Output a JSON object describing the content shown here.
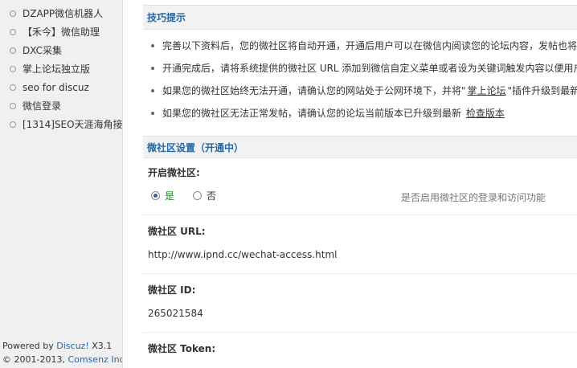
{
  "sidebar": {
    "items": [
      {
        "label": "DZAPP微信机器人"
      },
      {
        "label": "【禾今】微信助理"
      },
      {
        "label": "DXC采集"
      },
      {
        "label": "掌上论坛独立版"
      },
      {
        "label": "seo for discuz"
      },
      {
        "label": "微信登录"
      },
      {
        "label": "[1314]SEO天涯海角接"
      }
    ],
    "footer": {
      "powered_by": "Powered by",
      "discuz_link": "Discuz!",
      "version": "X3.1",
      "copyright": "© 2001-2013,",
      "comsenz_link": "Comsenz Inc."
    }
  },
  "tips": {
    "title": "技巧提示",
    "item1": "完善以下资料后，您的微社区将自动开通，开通后用户可以在微信内阅读您的论坛内容，发帖也将",
    "item2": "开通完成后，请将系统提供的微社区 URL 添加到微信自定义菜单或者设为关键词触发内容以便用户",
    "item3_before": "如果您的微社区始终无法开通，请确认您的网站处于公网环境下，并将\"",
    "item3_link": "掌上论坛",
    "item3_after": "\"插件升级到最新",
    "item4_text": "如果您的微社区无法正常发帖，请确认您的论坛当前版本已升级到最新",
    "item4_link": "检查版本"
  },
  "settings": {
    "title": "微社区设置（开通中）",
    "enable": {
      "label": "开启微社区:",
      "yes_label": "是",
      "no_label": "否",
      "selected": "是",
      "hint": "是否启用微社区的登录和访问功能"
    },
    "url": {
      "label": "微社区 URL:",
      "value": "http://www.ipnd.cc/wechat-access.html"
    },
    "id": {
      "label": "微社区 ID:",
      "value": "265021584"
    },
    "token": {
      "label": "微社区 Token:"
    }
  }
}
